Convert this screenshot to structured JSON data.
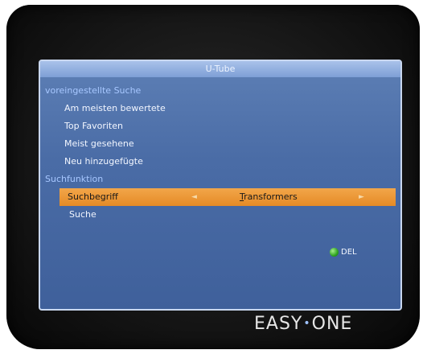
{
  "screen": {
    "title": "U-Tube"
  },
  "menu": {
    "preset_section_label": "voreingestellte Suche",
    "preset_items": [
      {
        "label": "Am meisten bewertete"
      },
      {
        "label": "Top Favoriten"
      },
      {
        "label": "Meist gesehene"
      },
      {
        "label": "Neu hinzugefügte"
      }
    ],
    "search_section_label": "Suchfunktion",
    "search_term": {
      "label": "Suchbegriff",
      "value_first": "T",
      "value_rest": "ransformers",
      "left_arrow": "◄",
      "right_arrow": "►"
    },
    "search_button_label": "Suche"
  },
  "hints": {
    "del_label": "DEL",
    "del_color": "#2fa320"
  },
  "device": {
    "brand_left": "EASY",
    "brand_dot": "•",
    "brand_right": "ONE"
  },
  "colors": {
    "highlight": "#e58a25",
    "panel": "#4a6ca6",
    "section_text": "#a7c7ff"
  }
}
